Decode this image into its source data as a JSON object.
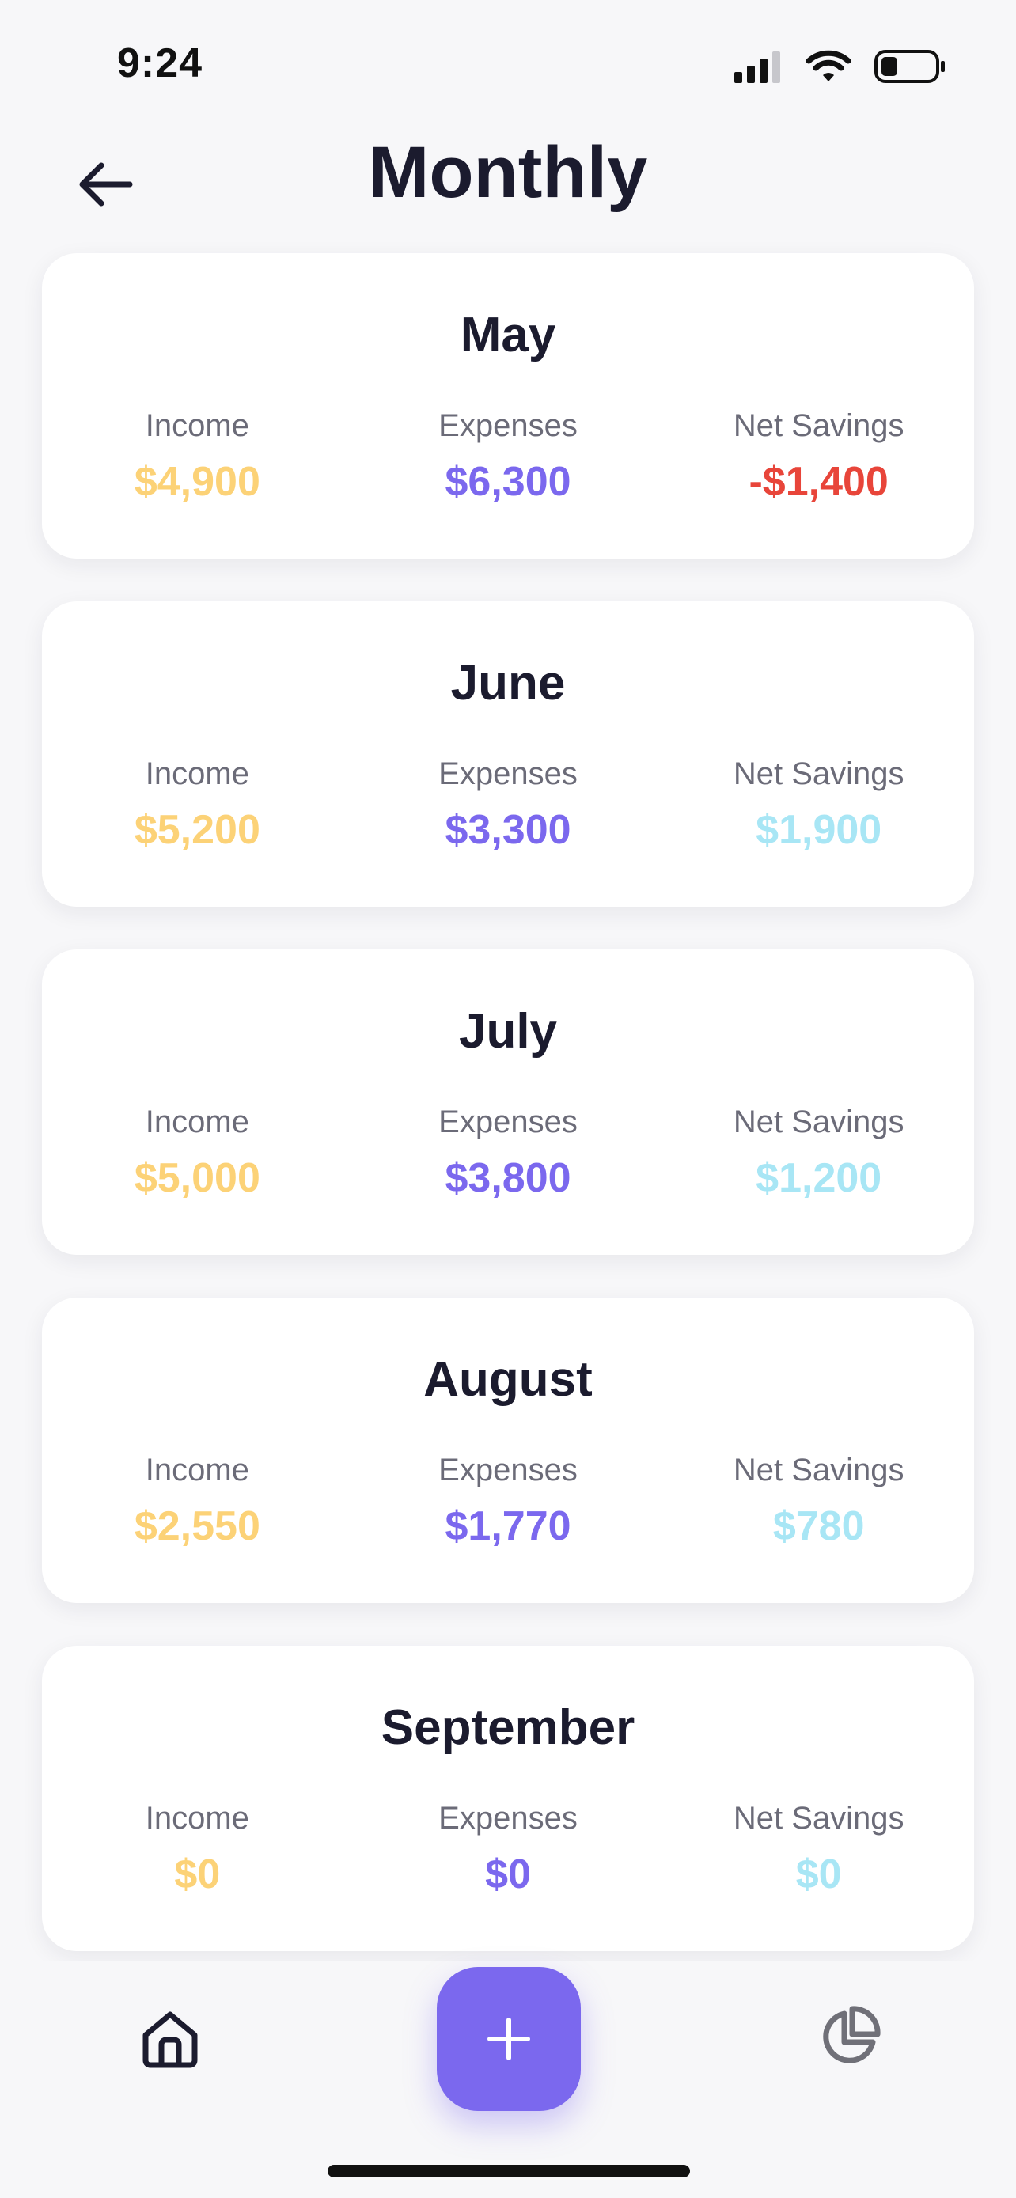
{
  "status_bar": {
    "time": "9:24",
    "icons": [
      "cellular-signal-icon",
      "wifi-icon",
      "battery-icon"
    ]
  },
  "header": {
    "title": "Monthly",
    "back_icon": "arrow-left-icon"
  },
  "colors": {
    "income": "#fcd277",
    "expenses": "#7b68ee",
    "savings_positive": "#a8e6f5",
    "savings_negative": "#e8453a",
    "accent": "#7b68ee"
  },
  "months": [
    {
      "name": "May",
      "income_label": "Income",
      "income": "$4,900",
      "expenses_label": "Expenses",
      "expenses": "$6,300",
      "savings_label": "Net Savings",
      "savings": "-$1,400",
      "savings_negative": true
    },
    {
      "name": "June",
      "income_label": "Income",
      "income": "$5,200",
      "expenses_label": "Expenses",
      "expenses": "$3,300",
      "savings_label": "Net Savings",
      "savings": "$1,900",
      "savings_negative": false
    },
    {
      "name": "July",
      "income_label": "Income",
      "income": "$5,000",
      "expenses_label": "Expenses",
      "expenses": "$3,800",
      "savings_label": "Net Savings",
      "savings": "$1,200",
      "savings_negative": false
    },
    {
      "name": "August",
      "income_label": "Income",
      "income": "$2,550",
      "expenses_label": "Expenses",
      "expenses": "$1,770",
      "savings_label": "Net Savings",
      "savings": "$780",
      "savings_negative": false
    },
    {
      "name": "September",
      "income_label": "Income",
      "income": "$0",
      "expenses_label": "Expenses",
      "expenses": "$0",
      "savings_label": "Net Savings",
      "savings": "$0",
      "savings_negative": false
    }
  ],
  "bottom_nav": {
    "home_icon": "home-icon",
    "add_icon": "plus-icon",
    "chart_icon": "pie-chart-icon"
  }
}
